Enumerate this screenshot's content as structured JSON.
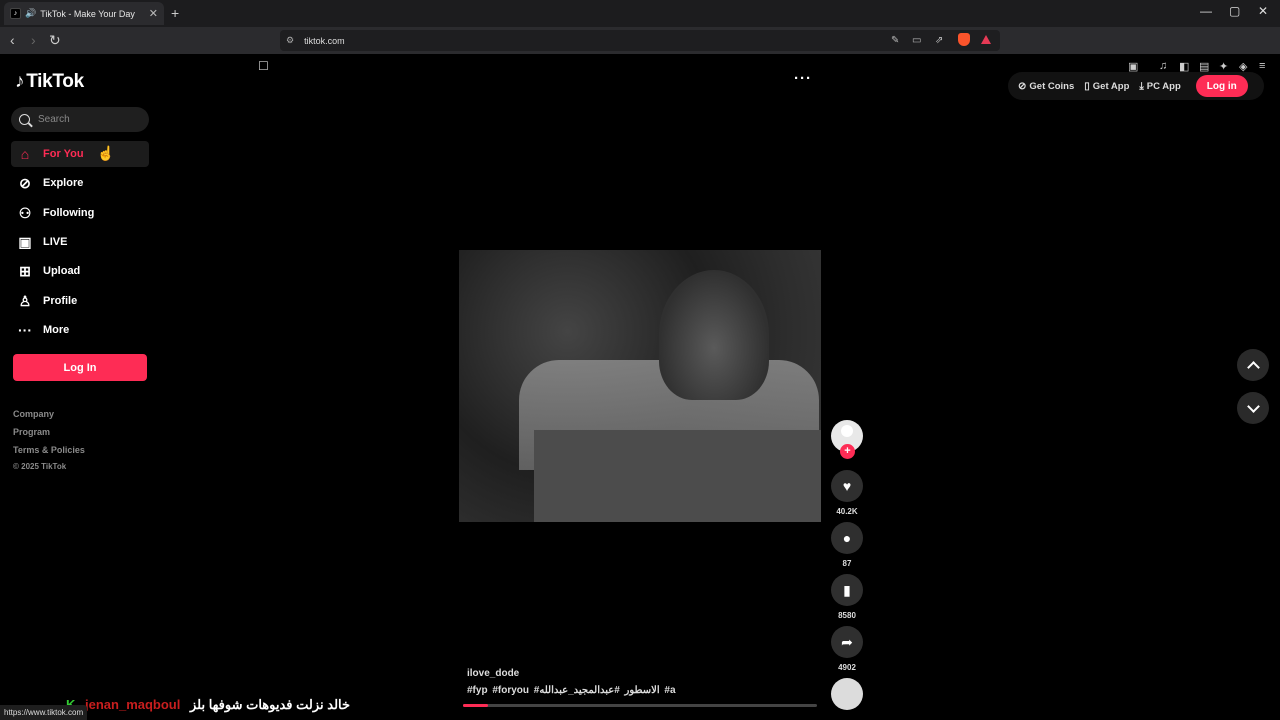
{
  "browser": {
    "tab_title": "TikTok - Make Your Day",
    "tab_close": "✕",
    "new_tab": "+",
    "url": "tiktok.com",
    "status_url": "https://www.tiktok.com"
  },
  "brand": {
    "logo_text": "TikTok"
  },
  "search": {
    "placeholder": "Search"
  },
  "sidebar": {
    "items": [
      {
        "label": "For You",
        "icon": "home-icon",
        "active": true
      },
      {
        "label": "Explore",
        "icon": "compass-icon"
      },
      {
        "label": "Following",
        "icon": "following-icon"
      },
      {
        "label": "LIVE",
        "icon": "live-icon"
      },
      {
        "label": "Upload",
        "icon": "upload-icon"
      },
      {
        "label": "Profile",
        "icon": "profile-icon"
      },
      {
        "label": "More",
        "icon": "more-icon"
      }
    ],
    "login_label": "Log In",
    "footer": {
      "company": "Company",
      "program": "Program",
      "terms": "Terms & Policies",
      "copyright": "© 2025 TikTok"
    }
  },
  "topbar": {
    "get_coins": "Get Coins",
    "get_app": "Get App",
    "pc_app": "PC App",
    "login": "Log in"
  },
  "video": {
    "author": "ilove_dode",
    "hashtags": "#fyp #foryou #الاسطور #عبدالمجيد_عبدالله #a",
    "progress": 0.07
  },
  "actions": {
    "likes": "40.2K",
    "comments": "87",
    "saves": "8580",
    "shares": "4902"
  },
  "overlay": {
    "k": "K",
    "username": "jenan_maqboul",
    "arabic": "خالد نزلت فديوهات شوفها بلز"
  },
  "colors": {
    "accent": "#fe2c55",
    "background": "#000000"
  }
}
